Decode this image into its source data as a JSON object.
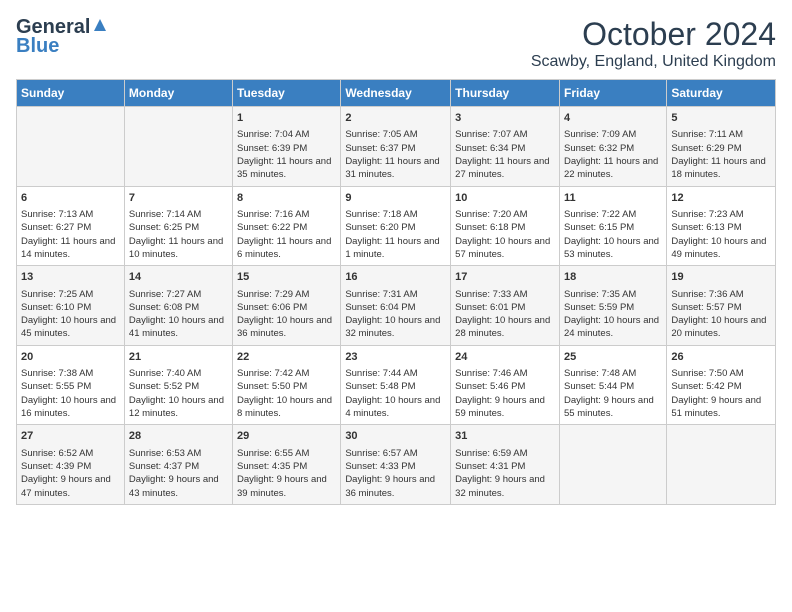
{
  "logo": {
    "general": "General",
    "blue": "Blue"
  },
  "title": "October 2024",
  "location": "Scawby, England, United Kingdom",
  "days": [
    "Sunday",
    "Monday",
    "Tuesday",
    "Wednesday",
    "Thursday",
    "Friday",
    "Saturday"
  ],
  "weeks": [
    [
      {
        "day": "",
        "content": ""
      },
      {
        "day": "",
        "content": ""
      },
      {
        "day": "1",
        "content": "Sunrise: 7:04 AM\nSunset: 6:39 PM\nDaylight: 11 hours and 35 minutes."
      },
      {
        "day": "2",
        "content": "Sunrise: 7:05 AM\nSunset: 6:37 PM\nDaylight: 11 hours and 31 minutes."
      },
      {
        "day": "3",
        "content": "Sunrise: 7:07 AM\nSunset: 6:34 PM\nDaylight: 11 hours and 27 minutes."
      },
      {
        "day": "4",
        "content": "Sunrise: 7:09 AM\nSunset: 6:32 PM\nDaylight: 11 hours and 22 minutes."
      },
      {
        "day": "5",
        "content": "Sunrise: 7:11 AM\nSunset: 6:29 PM\nDaylight: 11 hours and 18 minutes."
      }
    ],
    [
      {
        "day": "6",
        "content": "Sunrise: 7:13 AM\nSunset: 6:27 PM\nDaylight: 11 hours and 14 minutes."
      },
      {
        "day": "7",
        "content": "Sunrise: 7:14 AM\nSunset: 6:25 PM\nDaylight: 11 hours and 10 minutes."
      },
      {
        "day": "8",
        "content": "Sunrise: 7:16 AM\nSunset: 6:22 PM\nDaylight: 11 hours and 6 minutes."
      },
      {
        "day": "9",
        "content": "Sunrise: 7:18 AM\nSunset: 6:20 PM\nDaylight: 11 hours and 1 minute."
      },
      {
        "day": "10",
        "content": "Sunrise: 7:20 AM\nSunset: 6:18 PM\nDaylight: 10 hours and 57 minutes."
      },
      {
        "day": "11",
        "content": "Sunrise: 7:22 AM\nSunset: 6:15 PM\nDaylight: 10 hours and 53 minutes."
      },
      {
        "day": "12",
        "content": "Sunrise: 7:23 AM\nSunset: 6:13 PM\nDaylight: 10 hours and 49 minutes."
      }
    ],
    [
      {
        "day": "13",
        "content": "Sunrise: 7:25 AM\nSunset: 6:10 PM\nDaylight: 10 hours and 45 minutes."
      },
      {
        "day": "14",
        "content": "Sunrise: 7:27 AM\nSunset: 6:08 PM\nDaylight: 10 hours and 41 minutes."
      },
      {
        "day": "15",
        "content": "Sunrise: 7:29 AM\nSunset: 6:06 PM\nDaylight: 10 hours and 36 minutes."
      },
      {
        "day": "16",
        "content": "Sunrise: 7:31 AM\nSunset: 6:04 PM\nDaylight: 10 hours and 32 minutes."
      },
      {
        "day": "17",
        "content": "Sunrise: 7:33 AM\nSunset: 6:01 PM\nDaylight: 10 hours and 28 minutes."
      },
      {
        "day": "18",
        "content": "Sunrise: 7:35 AM\nSunset: 5:59 PM\nDaylight: 10 hours and 24 minutes."
      },
      {
        "day": "19",
        "content": "Sunrise: 7:36 AM\nSunset: 5:57 PM\nDaylight: 10 hours and 20 minutes."
      }
    ],
    [
      {
        "day": "20",
        "content": "Sunrise: 7:38 AM\nSunset: 5:55 PM\nDaylight: 10 hours and 16 minutes."
      },
      {
        "day": "21",
        "content": "Sunrise: 7:40 AM\nSunset: 5:52 PM\nDaylight: 10 hours and 12 minutes."
      },
      {
        "day": "22",
        "content": "Sunrise: 7:42 AM\nSunset: 5:50 PM\nDaylight: 10 hours and 8 minutes."
      },
      {
        "day": "23",
        "content": "Sunrise: 7:44 AM\nSunset: 5:48 PM\nDaylight: 10 hours and 4 minutes."
      },
      {
        "day": "24",
        "content": "Sunrise: 7:46 AM\nSunset: 5:46 PM\nDaylight: 9 hours and 59 minutes."
      },
      {
        "day": "25",
        "content": "Sunrise: 7:48 AM\nSunset: 5:44 PM\nDaylight: 9 hours and 55 minutes."
      },
      {
        "day": "26",
        "content": "Sunrise: 7:50 AM\nSunset: 5:42 PM\nDaylight: 9 hours and 51 minutes."
      }
    ],
    [
      {
        "day": "27",
        "content": "Sunrise: 6:52 AM\nSunset: 4:39 PM\nDaylight: 9 hours and 47 minutes."
      },
      {
        "day": "28",
        "content": "Sunrise: 6:53 AM\nSunset: 4:37 PM\nDaylight: 9 hours and 43 minutes."
      },
      {
        "day": "29",
        "content": "Sunrise: 6:55 AM\nSunset: 4:35 PM\nDaylight: 9 hours and 39 minutes."
      },
      {
        "day": "30",
        "content": "Sunrise: 6:57 AM\nSunset: 4:33 PM\nDaylight: 9 hours and 36 minutes."
      },
      {
        "day": "31",
        "content": "Sunrise: 6:59 AM\nSunset: 4:31 PM\nDaylight: 9 hours and 32 minutes."
      },
      {
        "day": "",
        "content": ""
      },
      {
        "day": "",
        "content": ""
      }
    ]
  ]
}
